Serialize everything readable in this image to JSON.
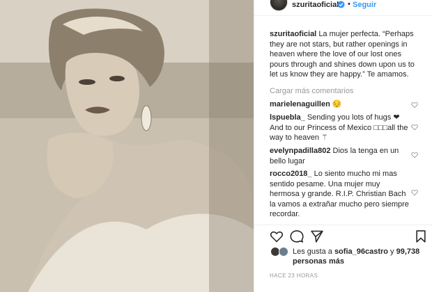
{
  "post": {
    "username": "szuritaoficial",
    "follow_label": "Seguir",
    "dot": "•"
  },
  "caption": {
    "user": "szuritaoficial",
    "text": "La mujer perfecta. “Perhaps they are not stars, but rather openings in heaven where the love of our lost ones pours through and shines down upon us to let us know they are happy.” Te amamos."
  },
  "load_more": "Cargar más comentarios",
  "comments": [
    {
      "user": "marielenaguillen",
      "text": "😔"
    },
    {
      "user": "lspuebla_",
      "text": "Sending you lots of hugs ❤ And to our Princess of Mexico □□□all the way to heaven ⚚"
    },
    {
      "user": "evelynpadilla802",
      "text": "Dios la tenga en un bello lugar"
    },
    {
      "user": "rocco2018_",
      "text": "Lo siento mucho mi mas sentido pesame. Una mujer muy hermosa y grande. R.I.P. Christian Bach la vamos a extrañar mucho pero siempre recordar."
    }
  ],
  "likes": {
    "prefix": "Les gusta a",
    "user": "sofia_96castro",
    "middle": "y",
    "count": "99,738 personas más"
  },
  "timestamp": "HACE 23 HORAS",
  "icons": {
    "verified": "verified-badge-icon",
    "like": "heart-icon",
    "comment": "comment-bubble-icon",
    "share": "share-icon",
    "save": "bookmark-icon"
  },
  "colors": {
    "accent": "#3897f0",
    "muted": "#999999",
    "text": "#262626"
  }
}
